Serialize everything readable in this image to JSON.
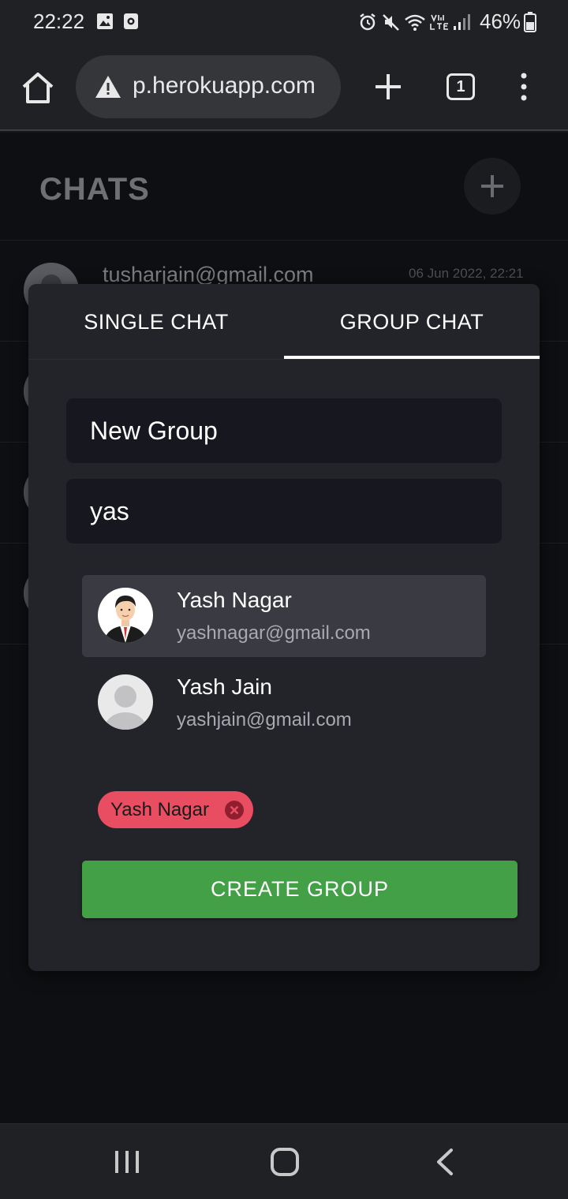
{
  "status_bar": {
    "time": "22:22",
    "battery_percent": "46%",
    "icons": [
      "gallery-icon",
      "screen-record-icon",
      "alarm-icon",
      "mute-icon",
      "wifi-icon",
      "volte-icon",
      "signal-icon",
      "battery-icon"
    ]
  },
  "browser": {
    "url": "p.herokuapp.com",
    "tab_count": "1",
    "icons": [
      "home-icon",
      "warning-icon",
      "new-tab-plus-icon",
      "tabs-icon",
      "overflow-menu-icon"
    ]
  },
  "page": {
    "title": "CHATS",
    "rows": [
      {
        "email": "tusharjain@gmail.com",
        "date": "06 Jun 2022, 22:21"
      }
    ]
  },
  "modal": {
    "tabs": [
      {
        "label": "SINGLE CHAT",
        "active": false
      },
      {
        "label": "GROUP CHAT",
        "active": true
      }
    ],
    "group_name_value": "New Group",
    "search_value": "yas",
    "results": [
      {
        "name": "Yash Nagar",
        "email": "yashnagar@gmail.com",
        "selected": true
      },
      {
        "name": "Yash Jain",
        "email": "yashjain@gmail.com",
        "selected": false
      }
    ],
    "selected_chips": [
      {
        "label": "Yash Nagar"
      }
    ],
    "create_label": "CREATE GROUP"
  },
  "colors": {
    "accent_green": "#43a047",
    "chip_red": "#e94d62",
    "modal_bg": "#23242a",
    "field_bg": "#17171f"
  }
}
